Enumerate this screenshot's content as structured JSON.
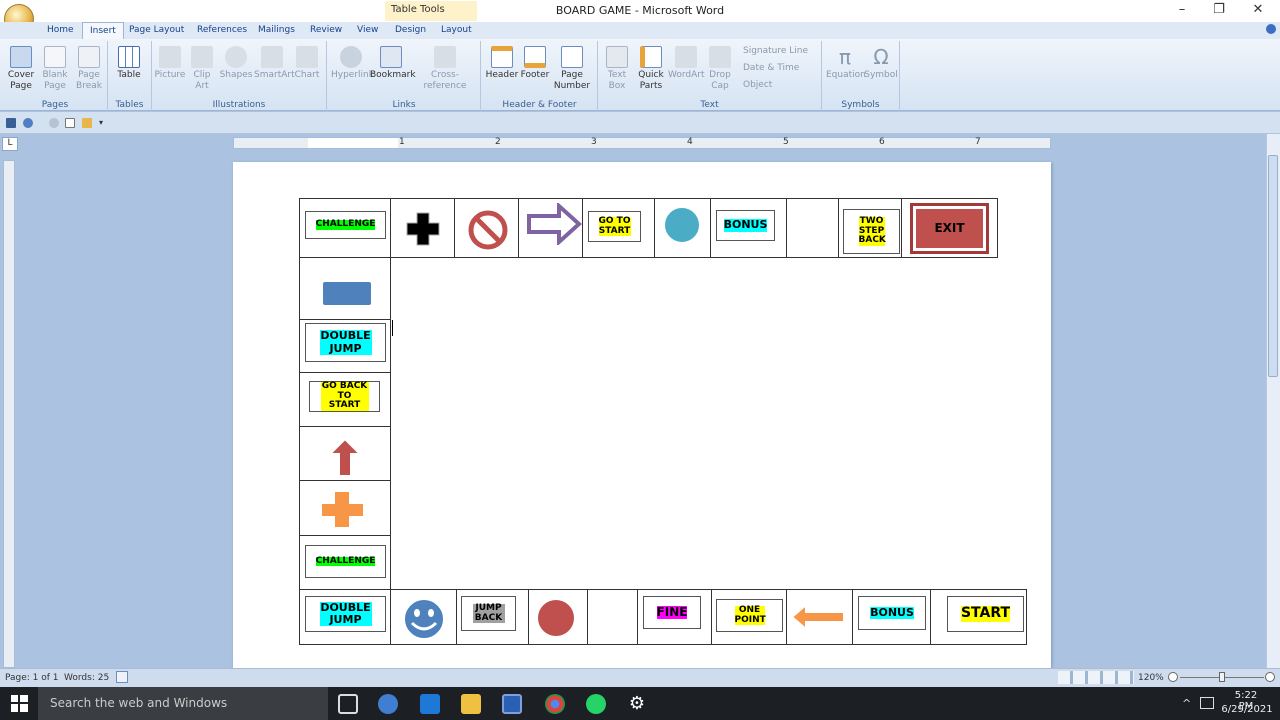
{
  "window": {
    "title": "BOARD GAME - Microsoft Word",
    "context_tab": "Table Tools"
  },
  "tabs": [
    "Home",
    "Insert",
    "Page Layout",
    "References",
    "Mailings",
    "Review",
    "View",
    "Design",
    "Layout"
  ],
  "ribbon": {
    "pages": {
      "label": "Pages",
      "items": [
        "Cover Page",
        "Blank Page",
        "Page Break"
      ]
    },
    "tables": {
      "label": "Tables",
      "items": [
        "Table"
      ]
    },
    "illustrations": {
      "label": "Illustrations",
      "items": [
        "Picture",
        "Clip Art",
        "Shapes",
        "SmartArt",
        "Chart"
      ]
    },
    "links": {
      "label": "Links",
      "items": [
        "Hyperlink",
        "Bookmark",
        "Cross-reference"
      ]
    },
    "header_footer": {
      "label": "Header & Footer",
      "items": [
        "Header",
        "Footer",
        "Page Number"
      ]
    },
    "text": {
      "label": "Text",
      "items": [
        "Text Box",
        "Quick Parts",
        "WordArt",
        "Drop Cap"
      ],
      "small": [
        "Signature Line",
        "Date & Time",
        "Object"
      ]
    },
    "symbols": {
      "label": "Symbols",
      "items": [
        "Equation",
        "Symbol"
      ]
    }
  },
  "ruler": {
    "numbers": [
      "1",
      "2",
      "3",
      "4",
      "5",
      "6",
      "7"
    ]
  },
  "board": {
    "top": {
      "challenge": "CHALLENGE",
      "go_to_start": "GO TO START",
      "bonus": "BONUS",
      "two_step_back": "TWO STEP BACK",
      "exit": "EXIT"
    },
    "left": {
      "double_jump": "DOUBLE JUMP",
      "go_back_to_start": "GO BACK TO START",
      "challenge": "CHALLENGE"
    },
    "bottom": {
      "double_jump": "DOUBLE JUMP",
      "jump_back": "JUMP BACK",
      "fine": "FINE",
      "one_point": "ONE POINT",
      "bonus": "BONUS",
      "start": "START"
    }
  },
  "status": {
    "page": "Page: 1 of 1",
    "words": "Words: 25",
    "zoom": "120%"
  },
  "taskbar": {
    "search": "Search the web and Windows",
    "time": "5:22 PM",
    "date": "6/29/2021"
  },
  "colors": {
    "highlight_green": "#00ff00",
    "highlight_yellow": "#ffff00",
    "highlight_cyan": "#00ffff",
    "highlight_magenta": "#ff00ff",
    "highlight_gray": "#a0a0a0"
  }
}
